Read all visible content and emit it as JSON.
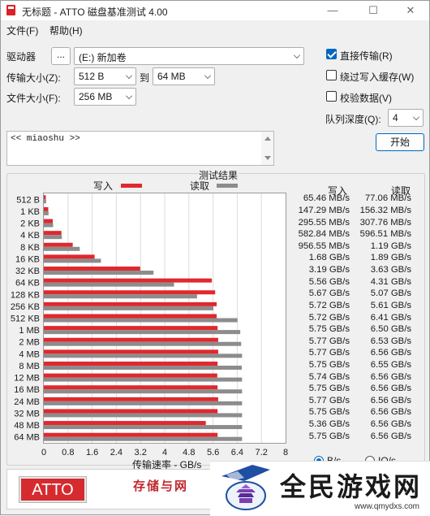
{
  "window": {
    "title": "无标题 - ATTO 磁盘基准测试 4.00",
    "minimize_glyph": "—",
    "maximize_glyph": "☐",
    "close_glyph": "✕"
  },
  "menu": {
    "file": "文件(F)",
    "help": "帮助(H)"
  },
  "controls": {
    "drive_label": "驱动器",
    "browse_label": "...",
    "drive_value": "(E:) 新加卷",
    "transfer_size_label": "传输大小(Z):",
    "transfer_from": "512 B",
    "to_label": "到",
    "transfer_to": "64 MB",
    "file_size_label": "文件大小(F):",
    "file_size": "256 MB",
    "direct_io_label": "直接传输(R)",
    "direct_io_checked": true,
    "bypass_cache_label": "绕过写入缓存(W)",
    "bypass_cache_checked": false,
    "verify_label": "校验数据(V)",
    "verify_checked": false,
    "queue_depth_label": "队列深度(Q):",
    "queue_depth": "4",
    "start_label": "开始",
    "description": "<< miaoshu >>"
  },
  "results": {
    "group_title": "测试结果",
    "write_legend": "写入",
    "read_legend": "读取",
    "write_header": "写入",
    "read_header": "读取",
    "xlabel": "传输速率 - GB/s",
    "write_color": "#e0282e",
    "read_color": "#8c8c8c",
    "radio_bytes_label": "B/s",
    "radio_io_label": "IO/s",
    "rows": [
      {
        "size": "512 B",
        "write": "65.46 MB/s",
        "read": "77.06 MB/s"
      },
      {
        "size": "1 KB",
        "write": "147.29 MB/s",
        "read": "156.32 MB/s"
      },
      {
        "size": "2 KB",
        "write": "295.55 MB/s",
        "read": "307.76 MB/s"
      },
      {
        "size": "4 KB",
        "write": "582.84 MB/s",
        "read": "596.51 MB/s"
      },
      {
        "size": "8 KB",
        "write": "956.55 MB/s",
        "read": "1.19 GB/s"
      },
      {
        "size": "16 KB",
        "write": "1.68 GB/s",
        "read": "1.89 GB/s"
      },
      {
        "size": "32 KB",
        "write": "3.19 GB/s",
        "read": "3.63 GB/s"
      },
      {
        "size": "64 KB",
        "write": "5.56 GB/s",
        "read": "4.31 GB/s"
      },
      {
        "size": "128 KB",
        "write": "5.67 GB/s",
        "read": "5.07 GB/s"
      },
      {
        "size": "256 KB",
        "write": "5.72 GB/s",
        "read": "5.61 GB/s"
      },
      {
        "size": "512 KB",
        "write": "5.72 GB/s",
        "read": "6.41 GB/s"
      },
      {
        "size": "1 MB",
        "write": "5.75 GB/s",
        "read": "6.50 GB/s"
      },
      {
        "size": "2 MB",
        "write": "5.77 GB/s",
        "read": "6.53 GB/s"
      },
      {
        "size": "4 MB",
        "write": "5.77 GB/s",
        "read": "6.56 GB/s"
      },
      {
        "size": "8 MB",
        "write": "5.75 GB/s",
        "read": "6.55 GB/s"
      },
      {
        "size": "12 MB",
        "write": "5.74 GB/s",
        "read": "6.56 GB/s"
      },
      {
        "size": "16 MB",
        "write": "5.75 GB/s",
        "read": "6.56 GB/s"
      },
      {
        "size": "24 MB",
        "write": "5.77 GB/s",
        "read": "6.56 GB/s"
      },
      {
        "size": "32 MB",
        "write": "5.75 GB/s",
        "read": "6.56 GB/s"
      },
      {
        "size": "48 MB",
        "write": "5.36 GB/s",
        "read": "6.56 GB/s"
      },
      {
        "size": "64 MB",
        "write": "5.75 GB/s",
        "read": "6.56 GB/s"
      }
    ]
  },
  "chart_data": {
    "type": "bar",
    "orientation": "horizontal",
    "categories": [
      "512 B",
      "1 KB",
      "2 KB",
      "4 KB",
      "8 KB",
      "16 KB",
      "32 KB",
      "64 KB",
      "128 KB",
      "256 KB",
      "512 KB",
      "1 MB",
      "2 MB",
      "4 MB",
      "8 MB",
      "12 MB",
      "16 MB",
      "24 MB",
      "32 MB",
      "48 MB",
      "64 MB"
    ],
    "series": [
      {
        "name": "写入",
        "color": "#e0282e",
        "values": [
          0.06546,
          0.14729,
          0.29555,
          0.58284,
          0.95655,
          1.68,
          3.19,
          5.56,
          5.67,
          5.72,
          5.72,
          5.75,
          5.77,
          5.77,
          5.75,
          5.74,
          5.75,
          5.77,
          5.75,
          5.36,
          5.75
        ]
      },
      {
        "name": "读取",
        "color": "#8c8c8c",
        "values": [
          0.07706,
          0.15632,
          0.30776,
          0.59651,
          1.19,
          1.89,
          3.63,
          4.31,
          5.07,
          5.61,
          6.41,
          6.5,
          6.53,
          6.56,
          6.55,
          6.56,
          6.56,
          6.56,
          6.56,
          6.56,
          6.56
        ]
      }
    ],
    "xlabel": "传输速率 - GB/s",
    "xlim": [
      0,
      8
    ],
    "xticks": [
      "0",
      "0.8",
      "1.6",
      "2.4",
      "3.2",
      "4",
      "4.8",
      "5.6",
      "6.4",
      "7.2",
      "8"
    ],
    "grid": true,
    "legend": "top"
  },
  "banner": {
    "logo_text": "ATTO",
    "slogan": "存储与网"
  },
  "watermark": {
    "title": "全民游戏网",
    "url": "www.qmydxs.com"
  }
}
